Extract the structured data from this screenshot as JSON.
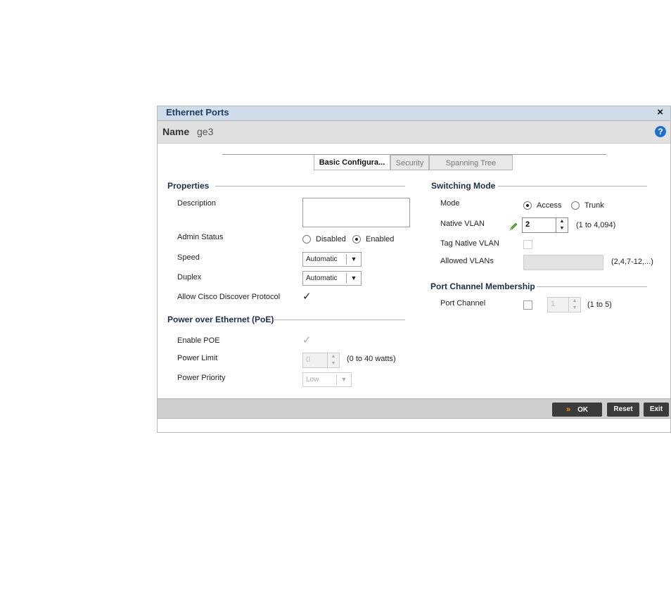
{
  "dialog": {
    "title": "Ethernet Ports",
    "close_icon": "×",
    "name_label": "Name",
    "name_value": "ge3",
    "help_icon": "?"
  },
  "tabs": [
    {
      "label": "Basic Configura...",
      "active": true
    },
    {
      "label": "Security",
      "active": false
    },
    {
      "label": "Spanning Tree",
      "active": false
    }
  ],
  "properties": {
    "section_title": "Properties",
    "description_label": "Description",
    "description_value": "",
    "admin_status_label": "Admin Status",
    "admin_status_options": [
      "Disabled",
      "Enabled"
    ],
    "admin_status_selected": "Enabled",
    "speed_label": "Speed",
    "speed_value": "Automatic",
    "duplex_label": "Duplex",
    "duplex_value": "Automatic",
    "cdp_label": "Allow Cisco Discover Protocol",
    "cdp_checked": true
  },
  "poe": {
    "section_title": "Power over Ethernet (PoE)",
    "enable_label": "Enable POE",
    "enable_checked": true,
    "power_limit_label": "Power Limit",
    "power_limit_value": "0",
    "power_limit_hint": "(0 to 40 watts)",
    "power_priority_label": "Power Priority",
    "power_priority_value": "Low"
  },
  "switching": {
    "section_title": "Switching Mode",
    "mode_label": "Mode",
    "mode_options": [
      "Access",
      "Trunk"
    ],
    "mode_selected": "Access",
    "native_vlan_label": "Native VLAN",
    "native_vlan_value": "2",
    "native_vlan_hint": "(1 to 4,094)",
    "tag_native_label": "Tag Native VLAN",
    "allowed_vlans_label": "Allowed VLANs",
    "allowed_vlans_hint": "(2,4,7-12,...)"
  },
  "port_channel": {
    "section_title": "Port Channel Membership",
    "label": "Port Channel",
    "value": "1",
    "hint": "(1 to 5)"
  },
  "footer": {
    "ok_label": "OK",
    "ok_arrow": "»",
    "reset_label": "Reset",
    "exit_label": "Exit"
  },
  "icons": {
    "dropdown_arrow": "▼",
    "spin_up": "▲",
    "spin_down": "▼",
    "check": "✓"
  },
  "colors": {
    "titlebar": "#cfdcea",
    "help": "#1f6fd0",
    "button": "#3b3b3b",
    "ok_arrow": "#f39c12"
  }
}
